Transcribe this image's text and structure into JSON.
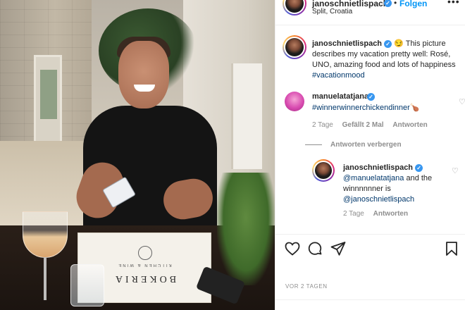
{
  "header": {
    "username": "janoschnietlispach",
    "verified_icon": "verified-badge-icon",
    "separator": "•",
    "follow_label": "Folgen",
    "location": "Split, Croatia",
    "more_icon": "more-options-icon",
    "more_glyph": "•••"
  },
  "caption": {
    "username": "janoschnietlispach",
    "emoji": "😏",
    "text": "This picture describes my vacation pretty well: Rosé, UNO, amazing food and lots of happiness",
    "hashtag": "#vacationmood"
  },
  "comment": {
    "username": "manuelatatjana",
    "text": "#winnerwinnerchickendinner",
    "emoji": "🍗",
    "age": "2 Tage",
    "likes": "Gefällt 2 Mal",
    "reply_label": "Antworten",
    "hide_replies_label": "Antworten verbergen"
  },
  "reply": {
    "username": "janoschnietlispach",
    "mention1": "@manuelatatjana",
    "text": "and the winnnnnner is",
    "mention2": "@janoschnietlispach",
    "age": "2 Tage",
    "reply_label": "Antworten"
  },
  "actions": {
    "like_icon": "heart-icon",
    "comment_icon": "comment-icon",
    "share_icon": "share-icon",
    "save_icon": "bookmark-icon"
  },
  "post_date": "VOR 2 TAGEN",
  "photo": {
    "menu_title": "BOKERIA",
    "menu_subtitle": "KITCHEN & WINE"
  },
  "colors": {
    "link_blue": "#0095f6",
    "hashtag_blue": "#00376b",
    "verified_blue": "#3897f0",
    "muted_gray": "#8e8e8e"
  }
}
